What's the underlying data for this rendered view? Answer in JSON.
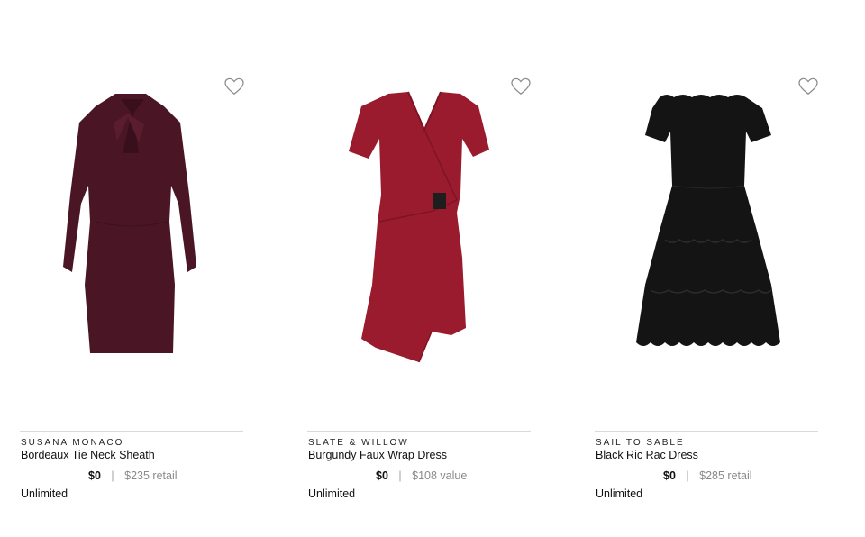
{
  "products": [
    {
      "brand": "SUSANA MONACO",
      "name": "Bordeaux Tie Neck Sheath",
      "price": "$0",
      "separator": "|",
      "retail": "$235 retail",
      "plan": "Unlimited",
      "dress_color": "#4a1626",
      "icon": "heart-icon"
    },
    {
      "brand": "SLATE & WILLOW",
      "name": "Burgundy Faux Wrap Dress",
      "price": "$0",
      "separator": "|",
      "retail": "$108 value",
      "plan": "Unlimited",
      "dress_color": "#9b1b2e",
      "icon": "heart-icon"
    },
    {
      "brand": "SAIL TO SABLE",
      "name": "Black Ric Rac Dress",
      "price": "$0",
      "separator": "|",
      "retail": "$285 retail",
      "plan": "Unlimited",
      "dress_color": "#141414",
      "icon": "heart-icon"
    }
  ]
}
